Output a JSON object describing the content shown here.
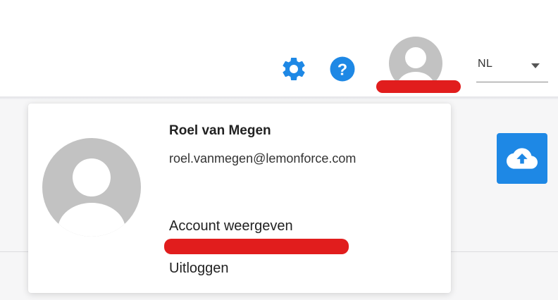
{
  "header": {
    "icons": {
      "settings": "gear-icon",
      "help": "help-circle-icon",
      "user": "user-avatar-icon"
    },
    "language": {
      "selected": "NL"
    }
  },
  "upload_button": {
    "icon": "cloud-upload-icon"
  },
  "user_menu": {
    "name": "Roel van Megen",
    "email": "roel.vanmegen@lemonforce.com",
    "account_label": "Account weergeven",
    "logout_label": "Uitloggen"
  },
  "colors": {
    "accent": "#1e88e5",
    "highlight_mark": "#e11d1d",
    "avatar_gray": "#c2c2c2"
  }
}
